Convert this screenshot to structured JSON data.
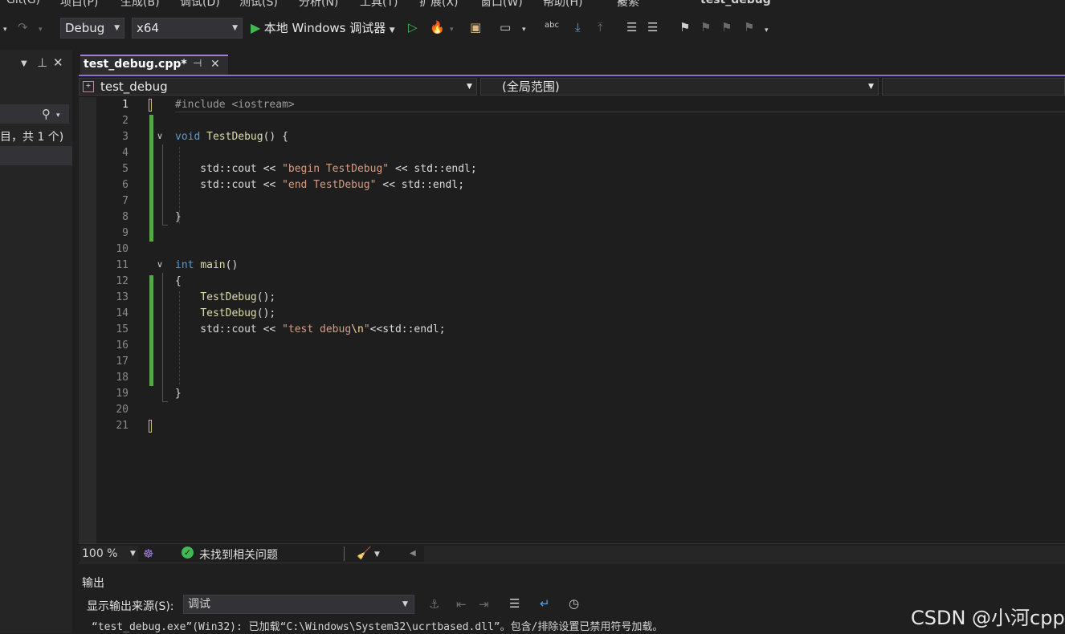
{
  "menu": [
    "Git(G)",
    "项目(P)",
    "生成(B)",
    "调试(D)",
    "测试(S)",
    "分析(N)",
    "工具(T)",
    "扩展(X)",
    "窗口(W)",
    "帮助(H)",
    "搜索",
    "test_debug"
  ],
  "toolbar": {
    "config": "Debug",
    "platform": "x64",
    "run_label": "本地 Windows 调试器"
  },
  "left_panel": {
    "summary": "目，共 1 个)"
  },
  "tab": {
    "title": "test_debug.cpp*",
    "pin": "⊣",
    "close": "✕"
  },
  "navbar": {
    "project": "test_debug",
    "scope": "(全局范围)"
  },
  "editor": {
    "line_numbers": [
      "1",
      "2",
      "3",
      "4",
      "5",
      "6",
      "7",
      "8",
      "9",
      "10",
      "11",
      "12",
      "13",
      "14",
      "15",
      "16",
      "17",
      "18",
      "19",
      "20",
      "21"
    ]
  },
  "status": {
    "zoom": "100 %",
    "issues": "未找到相关问题"
  },
  "output": {
    "title": "输出",
    "source_label": "显示输出来源(S):",
    "source_value": "调试",
    "log_line": "“test_debug.exe”(Win32): 已加载“C:\\Windows\\System32\\ucrtbased.dll”。包含/排除设置已禁用符号加载。"
  },
  "watermark": "CSDN @小河cpp",
  "colors": {
    "accent": "#8c6fd1",
    "keyword": "#569cd6",
    "function": "#dcdcaa",
    "string": "#d69d85",
    "change_bar": "#57a64a",
    "ok_status": "#3fb950"
  }
}
